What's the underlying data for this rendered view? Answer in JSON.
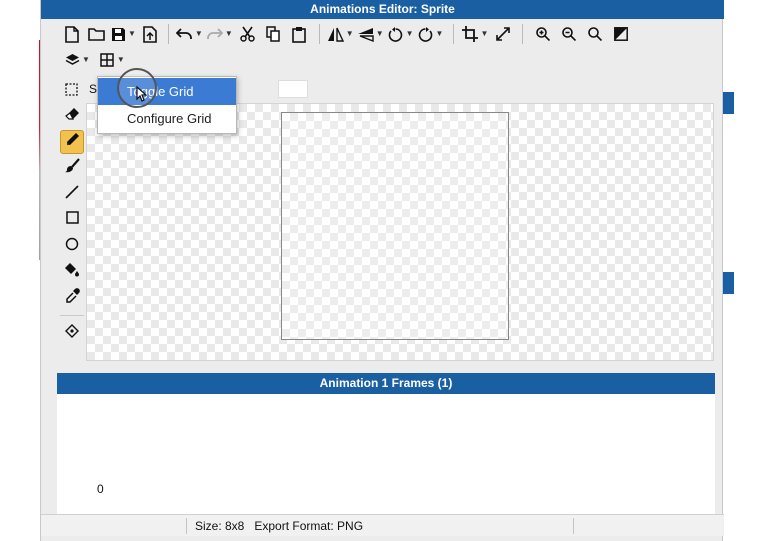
{
  "window": {
    "title": "Animations Editor: Sprite"
  },
  "toolbar": {
    "buttons": [
      {
        "name": "new-file",
        "icon": "file-icon"
      },
      {
        "name": "open-folder",
        "icon": "folder-icon"
      },
      {
        "name": "save",
        "icon": "save-icon",
        "dropdown": true
      },
      {
        "name": "export",
        "icon": "export-icon"
      },
      {
        "name": "undo",
        "icon": "undo-icon",
        "dropdown": true
      },
      {
        "name": "redo",
        "icon": "redo-icon",
        "dropdown": true
      },
      {
        "name": "cut",
        "icon": "scissors-icon"
      },
      {
        "name": "copy",
        "icon": "copy-icon"
      },
      {
        "name": "paste",
        "icon": "clipboard-icon"
      },
      {
        "name": "flip-horizontal",
        "icon": "flip-horizontal-icon",
        "dropdown": true
      },
      {
        "name": "flip-vertical",
        "icon": "flip-vertical-icon",
        "dropdown": true
      },
      {
        "name": "rotate-left",
        "icon": "rotate-left-icon",
        "dropdown": true
      },
      {
        "name": "rotate-right",
        "icon": "rotate-right-icon",
        "dropdown": true
      },
      {
        "name": "crop",
        "icon": "crop-icon",
        "dropdown": true
      },
      {
        "name": "resize",
        "icon": "resize-icon"
      },
      {
        "name": "zoom-in",
        "icon": "zoom-in-icon"
      },
      {
        "name": "zoom-out",
        "icon": "zoom-out-icon"
      },
      {
        "name": "zoom-fit",
        "icon": "zoom-icon"
      },
      {
        "name": "background",
        "icon": "contrast-icon"
      }
    ],
    "row2": [
      {
        "name": "layers",
        "icon": "layers-icon",
        "dropdown": true
      },
      {
        "name": "grid",
        "icon": "grid-icon",
        "dropdown": true
      }
    ]
  },
  "selection": {
    "label": "S"
  },
  "grid_menu": {
    "items": [
      {
        "label": "Toggle Grid",
        "highlighted": true
      },
      {
        "label": "Configure Grid",
        "highlighted": false
      }
    ]
  },
  "tools": [
    {
      "name": "select",
      "icon": "marquee-icon",
      "active": false
    },
    {
      "name": "eraser",
      "icon": "eraser-icon",
      "active": false
    },
    {
      "name": "pencil",
      "icon": "pencil-icon",
      "active": true
    },
    {
      "name": "brush",
      "icon": "brush-icon",
      "active": false
    },
    {
      "name": "line",
      "icon": "line-icon",
      "active": false
    },
    {
      "name": "rectangle",
      "icon": "rectangle-icon",
      "active": false
    },
    {
      "name": "ellipse",
      "icon": "circle-icon",
      "active": false
    },
    {
      "name": "fill",
      "icon": "paint-bucket-icon",
      "active": false
    },
    {
      "name": "eyedropper",
      "icon": "eyedropper-icon",
      "active": false
    },
    {
      "name": "pivot",
      "icon": "pivot-icon",
      "active": false
    }
  ],
  "frames": {
    "title": "Animation 1 Frames (1)",
    "index_label": "0"
  },
  "status": {
    "text": "Size: 8x8   Export Format: PNG"
  },
  "colors": {
    "titlebar": "#1b5fa3",
    "menu_highlight": "#3c7bd4",
    "active_tool": "#f2c14e"
  }
}
